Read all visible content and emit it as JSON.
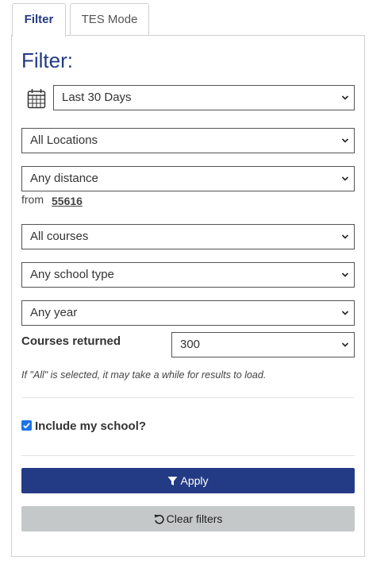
{
  "tabs": [
    {
      "label": "Filter",
      "active": true
    },
    {
      "label": "TES Mode",
      "active": false
    }
  ],
  "panel": {
    "title": "Filter:"
  },
  "filters": {
    "date_range": "Last 30 Days",
    "location": "All Locations",
    "distance": "Any distance",
    "from_label": "from",
    "zip": "55616",
    "courses": "All courses",
    "school_type": "Any school type",
    "year": "Any year",
    "courses_returned_label": "Courses returned",
    "courses_returned_value": "300",
    "note": "If \"All\" is selected, it may take a while for results to load.",
    "include_school_label": "Include my school?",
    "include_school_checked": true
  },
  "buttons": {
    "apply": "Apply",
    "clear": "Clear filters"
  },
  "colors": {
    "accent": "#233a85",
    "checkbox": "#1a73e8",
    "clear_bg": "#c4c8c9"
  },
  "icons": {
    "calendar": "calendar-icon",
    "filter": "filter-icon",
    "reset": "reset-icon",
    "chevron": "chevron-down-icon"
  }
}
